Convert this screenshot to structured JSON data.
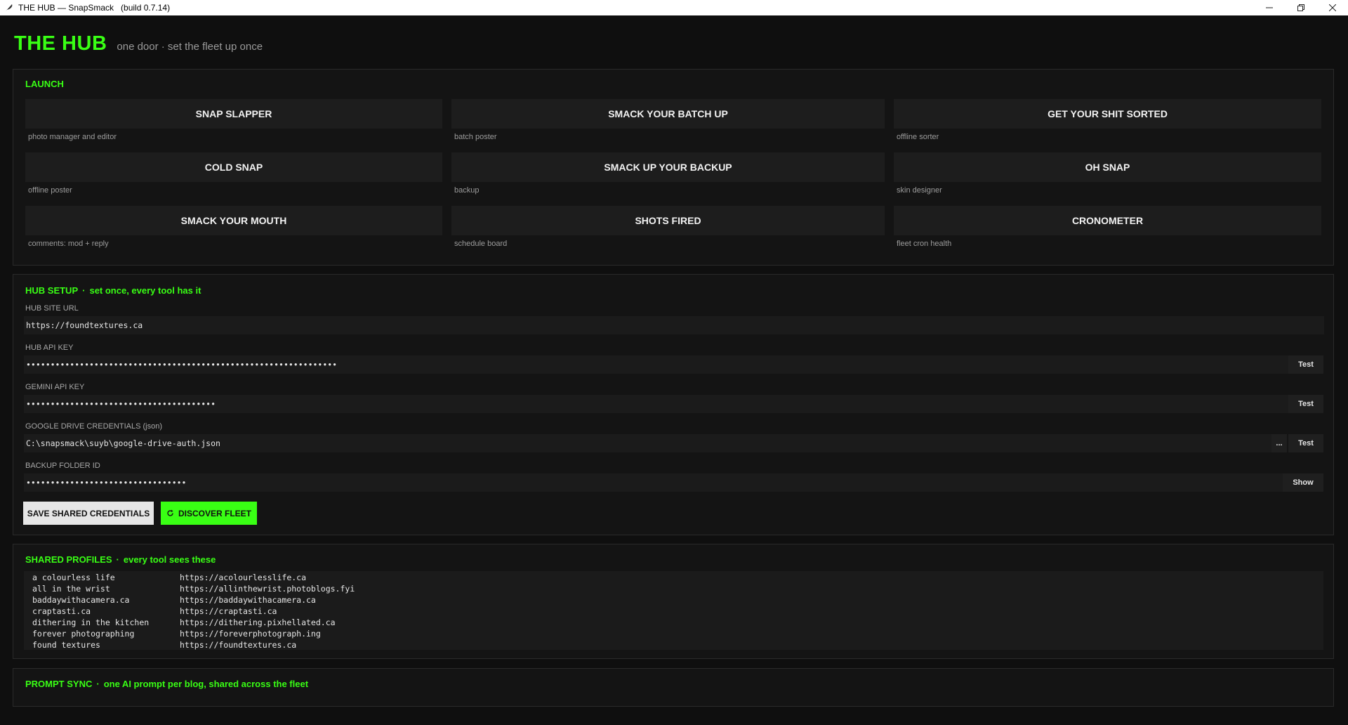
{
  "window": {
    "title": "THE HUB — SnapSmack   (build 0.7.14)",
    "icon": "feather-icon",
    "controls": [
      "minimize-icon",
      "restore-icon",
      "close-icon"
    ]
  },
  "header": {
    "title": "THE HUB",
    "subtitle": "one door · set the fleet up once"
  },
  "launch": {
    "label": "LAUNCH",
    "tools": [
      {
        "name": "SNAP SLAPPER",
        "desc": "photo manager and editor"
      },
      {
        "name": "SMACK YOUR BATCH UP",
        "desc": "batch poster"
      },
      {
        "name": "GET YOUR SHIT SORTED",
        "desc": "offline sorter"
      },
      {
        "name": "COLD SNAP",
        "desc": "offline poster"
      },
      {
        "name": "SMACK UP YOUR BACKUP",
        "desc": "backup"
      },
      {
        "name": "OH SNAP",
        "desc": "skin designer"
      },
      {
        "name": "SMACK YOUR MOUTH",
        "desc": "comments: mod + reply"
      },
      {
        "name": "SHOTS FIRED",
        "desc": "schedule board"
      },
      {
        "name": "CRONOMETER",
        "desc": "fleet cron health"
      }
    ]
  },
  "setup": {
    "label": "HUB SETUP",
    "tagline": "set once, every tool has it",
    "fields": [
      {
        "label": "HUB SITE URL",
        "value": "https://foundtextures.ca"
      },
      {
        "label": "HUB API KEY",
        "value": "••••••••••••••••••••••••••••••••••••••••••••••••••••••••••••••••",
        "button": "Test"
      },
      {
        "label": "GEMINI API KEY",
        "value": "•••••••••••••••••••••••••••••••••••••••",
        "button": "Test"
      },
      {
        "label": "GOOGLE DRIVE CREDENTIALS (json)",
        "value": "C:\\snapsmack\\suyb\\google-drive-auth.json",
        "browse": "...",
        "button": "Test"
      },
      {
        "label": "BACKUP FOLDER ID",
        "value": "•••••••••••••••••••••••••••••••••",
        "button": "Show"
      }
    ],
    "save_label": "SAVE SHARED CREDENTIALS",
    "discover_label": "DISCOVER FLEET"
  },
  "profiles": {
    "label": "SHARED PROFILES",
    "tagline": "every tool sees these",
    "rows": [
      {
        "name": "a colourless life",
        "url": "https://acolourlesslife.ca"
      },
      {
        "name": "all in the wrist",
        "url": "https://allinthewrist.photoblogs.fyi"
      },
      {
        "name": "baddaywithacamera.ca",
        "url": "https://baddaywithacamera.ca"
      },
      {
        "name": "craptasti.ca",
        "url": "https://craptasti.ca"
      },
      {
        "name": "dithering in the kitchen",
        "url": "https://dithering.pixhellated.ca"
      },
      {
        "name": "forever photographing",
        "url": "https://foreverphotograph.ing"
      },
      {
        "name": "found textures",
        "url": "https://foundtextures.ca"
      }
    ]
  },
  "prompt_sync": {
    "label": "PROMPT SYNC",
    "tagline": "one AI prompt per blog, shared across the fleet"
  },
  "colors": {
    "accent": "#39ff14",
    "background": "#0f0f0f",
    "panel": "#141414"
  }
}
